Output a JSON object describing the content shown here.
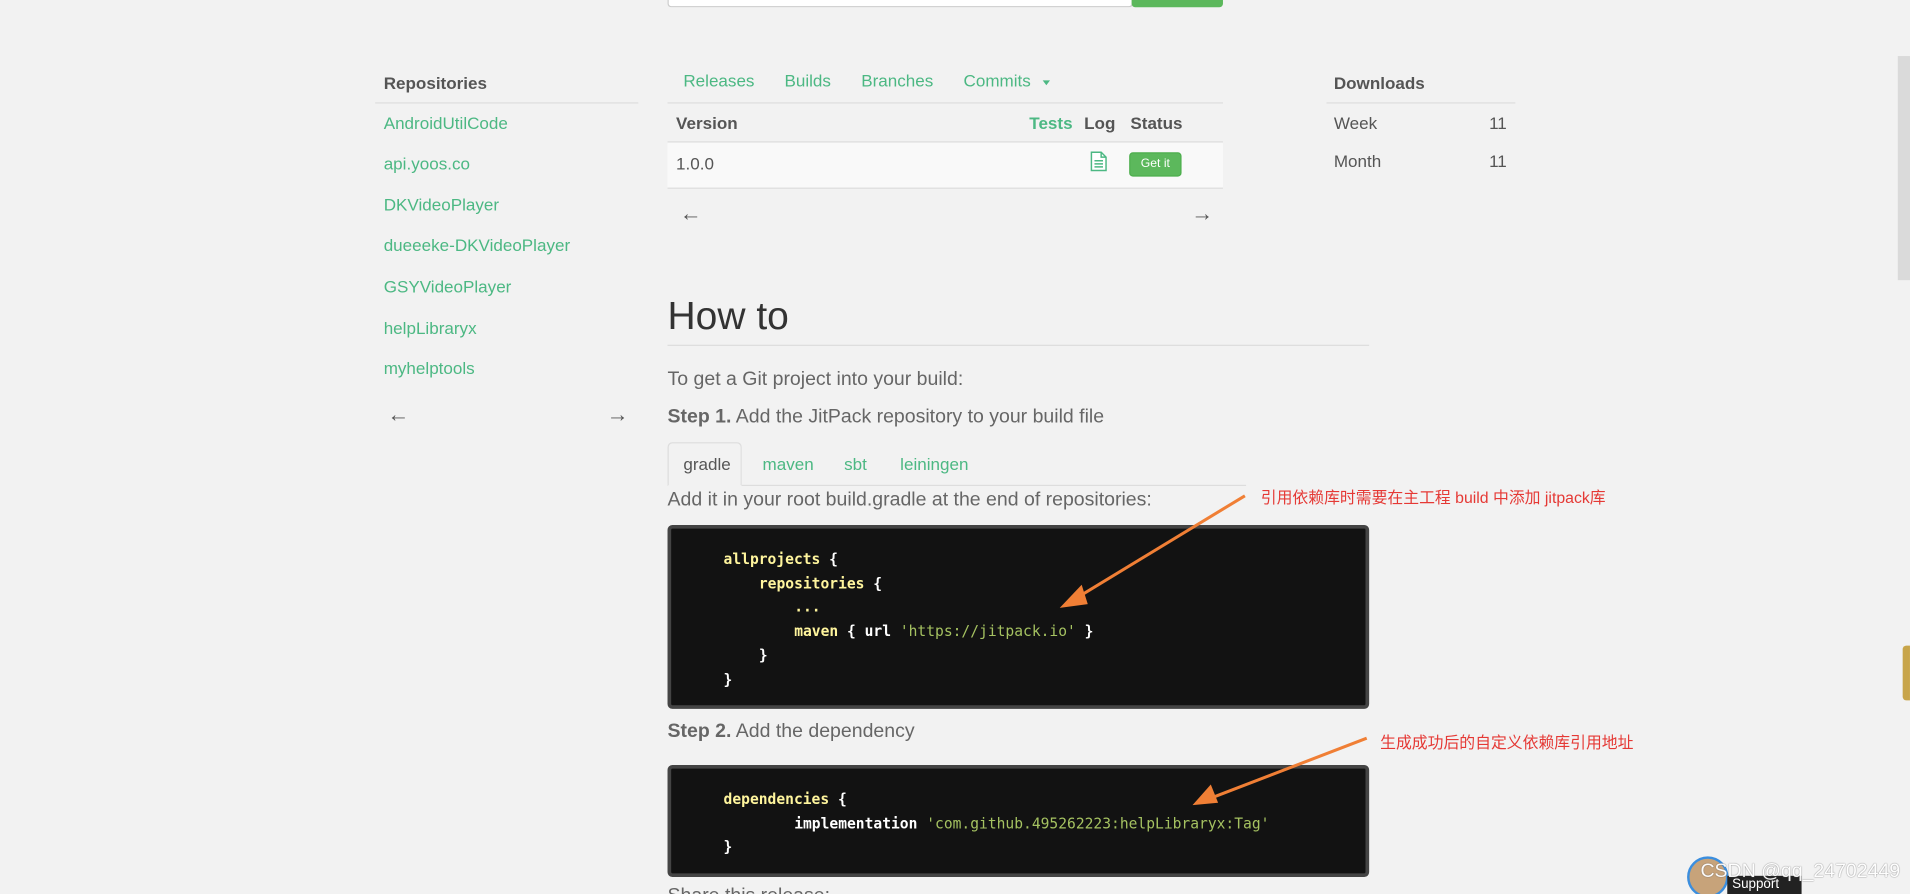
{
  "repositories": {
    "title": "Repositories",
    "items": [
      "AndroidUtilCode",
      "api.yoos.co",
      "DKVideoPlayer",
      "dueeeke-DKVideoPlayer",
      "GSYVideoPlayer",
      "helpLibraryx",
      "myhelptools"
    ],
    "prev": "←",
    "next": "→"
  },
  "tabs": [
    "Releases",
    "Builds",
    "Branches",
    "Commits"
  ],
  "table": {
    "headers": {
      "version": "Version",
      "tests": "Tests",
      "log": "Log",
      "status": "Status"
    },
    "rows": [
      {
        "version": "1.0.0",
        "status_button": "Get it"
      }
    ],
    "prev": "←",
    "next": "→"
  },
  "downloads": {
    "title": "Downloads",
    "rows": [
      {
        "label": "Week",
        "value": "11"
      },
      {
        "label": "Month",
        "value": "11"
      }
    ]
  },
  "howto": {
    "title": "How to",
    "intro": "To get a Git project into your build:",
    "step1_label": "Step 1.",
    "step1_text": " Add the JitPack repository to your build file",
    "build_tabs": [
      "gradle",
      "maven",
      "sbt",
      "leiningen"
    ],
    "add_text": "Add it in your root build.gradle at the end of repositories:",
    "code1": {
      "l1_kw": "allprojects",
      "l1_rest": " {",
      "l2_kw": "repositories",
      "l2_rest": " {",
      "l3": "...",
      "l4_kw": "maven",
      "l4_mid": " { url ",
      "l4_str": "'https://jitpack.io'",
      "l4_end": " }",
      "l5": "}",
      "l6": "}"
    },
    "step2_label": "Step 2.",
    "step2_text": " Add the dependency",
    "code2": {
      "l1_kw": "dependencies",
      "l1_rest": " {",
      "l2_kw": "implementation",
      "l2_str": " 'com.github.495262223:helpLibraryx:Tag'",
      "l3": "}"
    },
    "cutoff_text": "Share this release:"
  },
  "annotations": {
    "note1": "引用依赖库时需要在主工程 build 中添加 jitpack库",
    "note2": "生成成功后的自定义依赖库引用地址"
  },
  "overlay": {
    "watermark": "CSDN @qq_24702449",
    "support": "Support"
  },
  "colors": {
    "link": "#4cb883",
    "button": "#5cb85c",
    "arrow": "#f07f35",
    "note": "#e53935",
    "code_bg": "#121212"
  }
}
